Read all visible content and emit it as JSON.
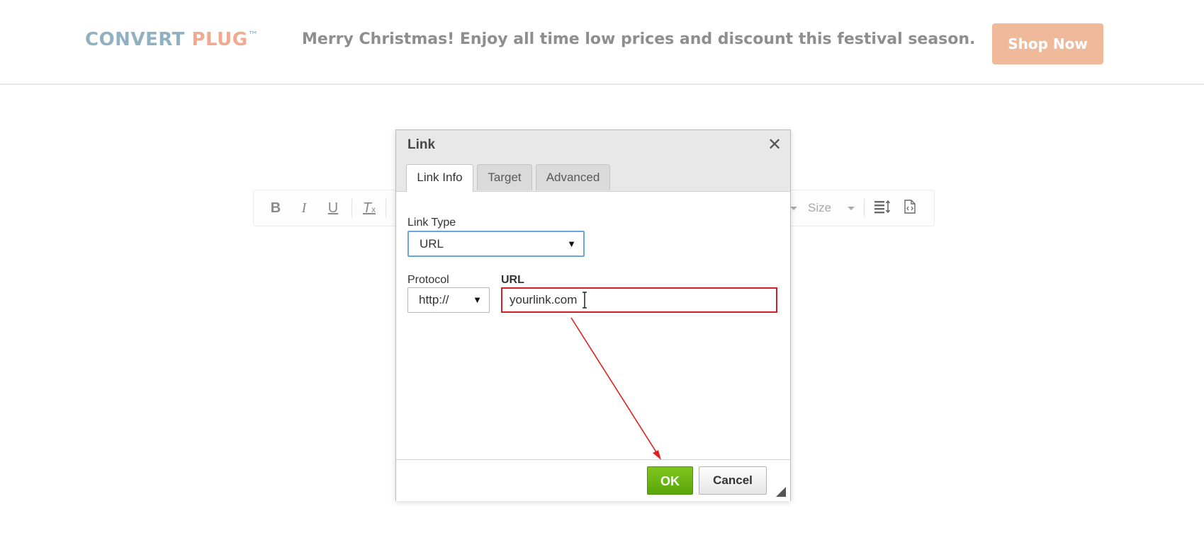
{
  "banner": {
    "logo_part1": "CONVERT",
    "logo_part2": "PLUG",
    "logo_tm": "™",
    "promo_text": "Merry Christmas! Enjoy all time low prices and discount this festival season.",
    "shop_button": "Shop Now",
    "colors": {
      "logo_blue": "#8fb1c2",
      "logo_orange": "#f0aa8f",
      "shop_button_bg": "#f0b99a"
    }
  },
  "toolbar": {
    "bold_label": "B",
    "italic_label": "I",
    "underline_label": "U",
    "clear_format_label": "T",
    "size_label": "Size",
    "icons": [
      "bold-icon",
      "italic-icon",
      "underline-icon",
      "remove-format-icon",
      "size-dropdown",
      "line-height-icon",
      "source-code-icon"
    ]
  },
  "dialog": {
    "title": "Link",
    "close_glyph": "✕",
    "tabs": [
      {
        "label": "Link Info",
        "active": true
      },
      {
        "label": "Target",
        "active": false
      },
      {
        "label": "Advanced",
        "active": false
      }
    ],
    "link_type_label": "Link Type",
    "link_type_value": "URL",
    "protocol_label": "Protocol",
    "protocol_value": "http://",
    "url_label": "URL",
    "url_value": "yourlink.com",
    "ok_label": "OK",
    "cancel_label": "Cancel",
    "colors": {
      "ok_green": "#6bb514",
      "error_border": "#d81f26",
      "focus_blue": "#6aa7e0",
      "annotation_arrow": "#e02020"
    }
  }
}
